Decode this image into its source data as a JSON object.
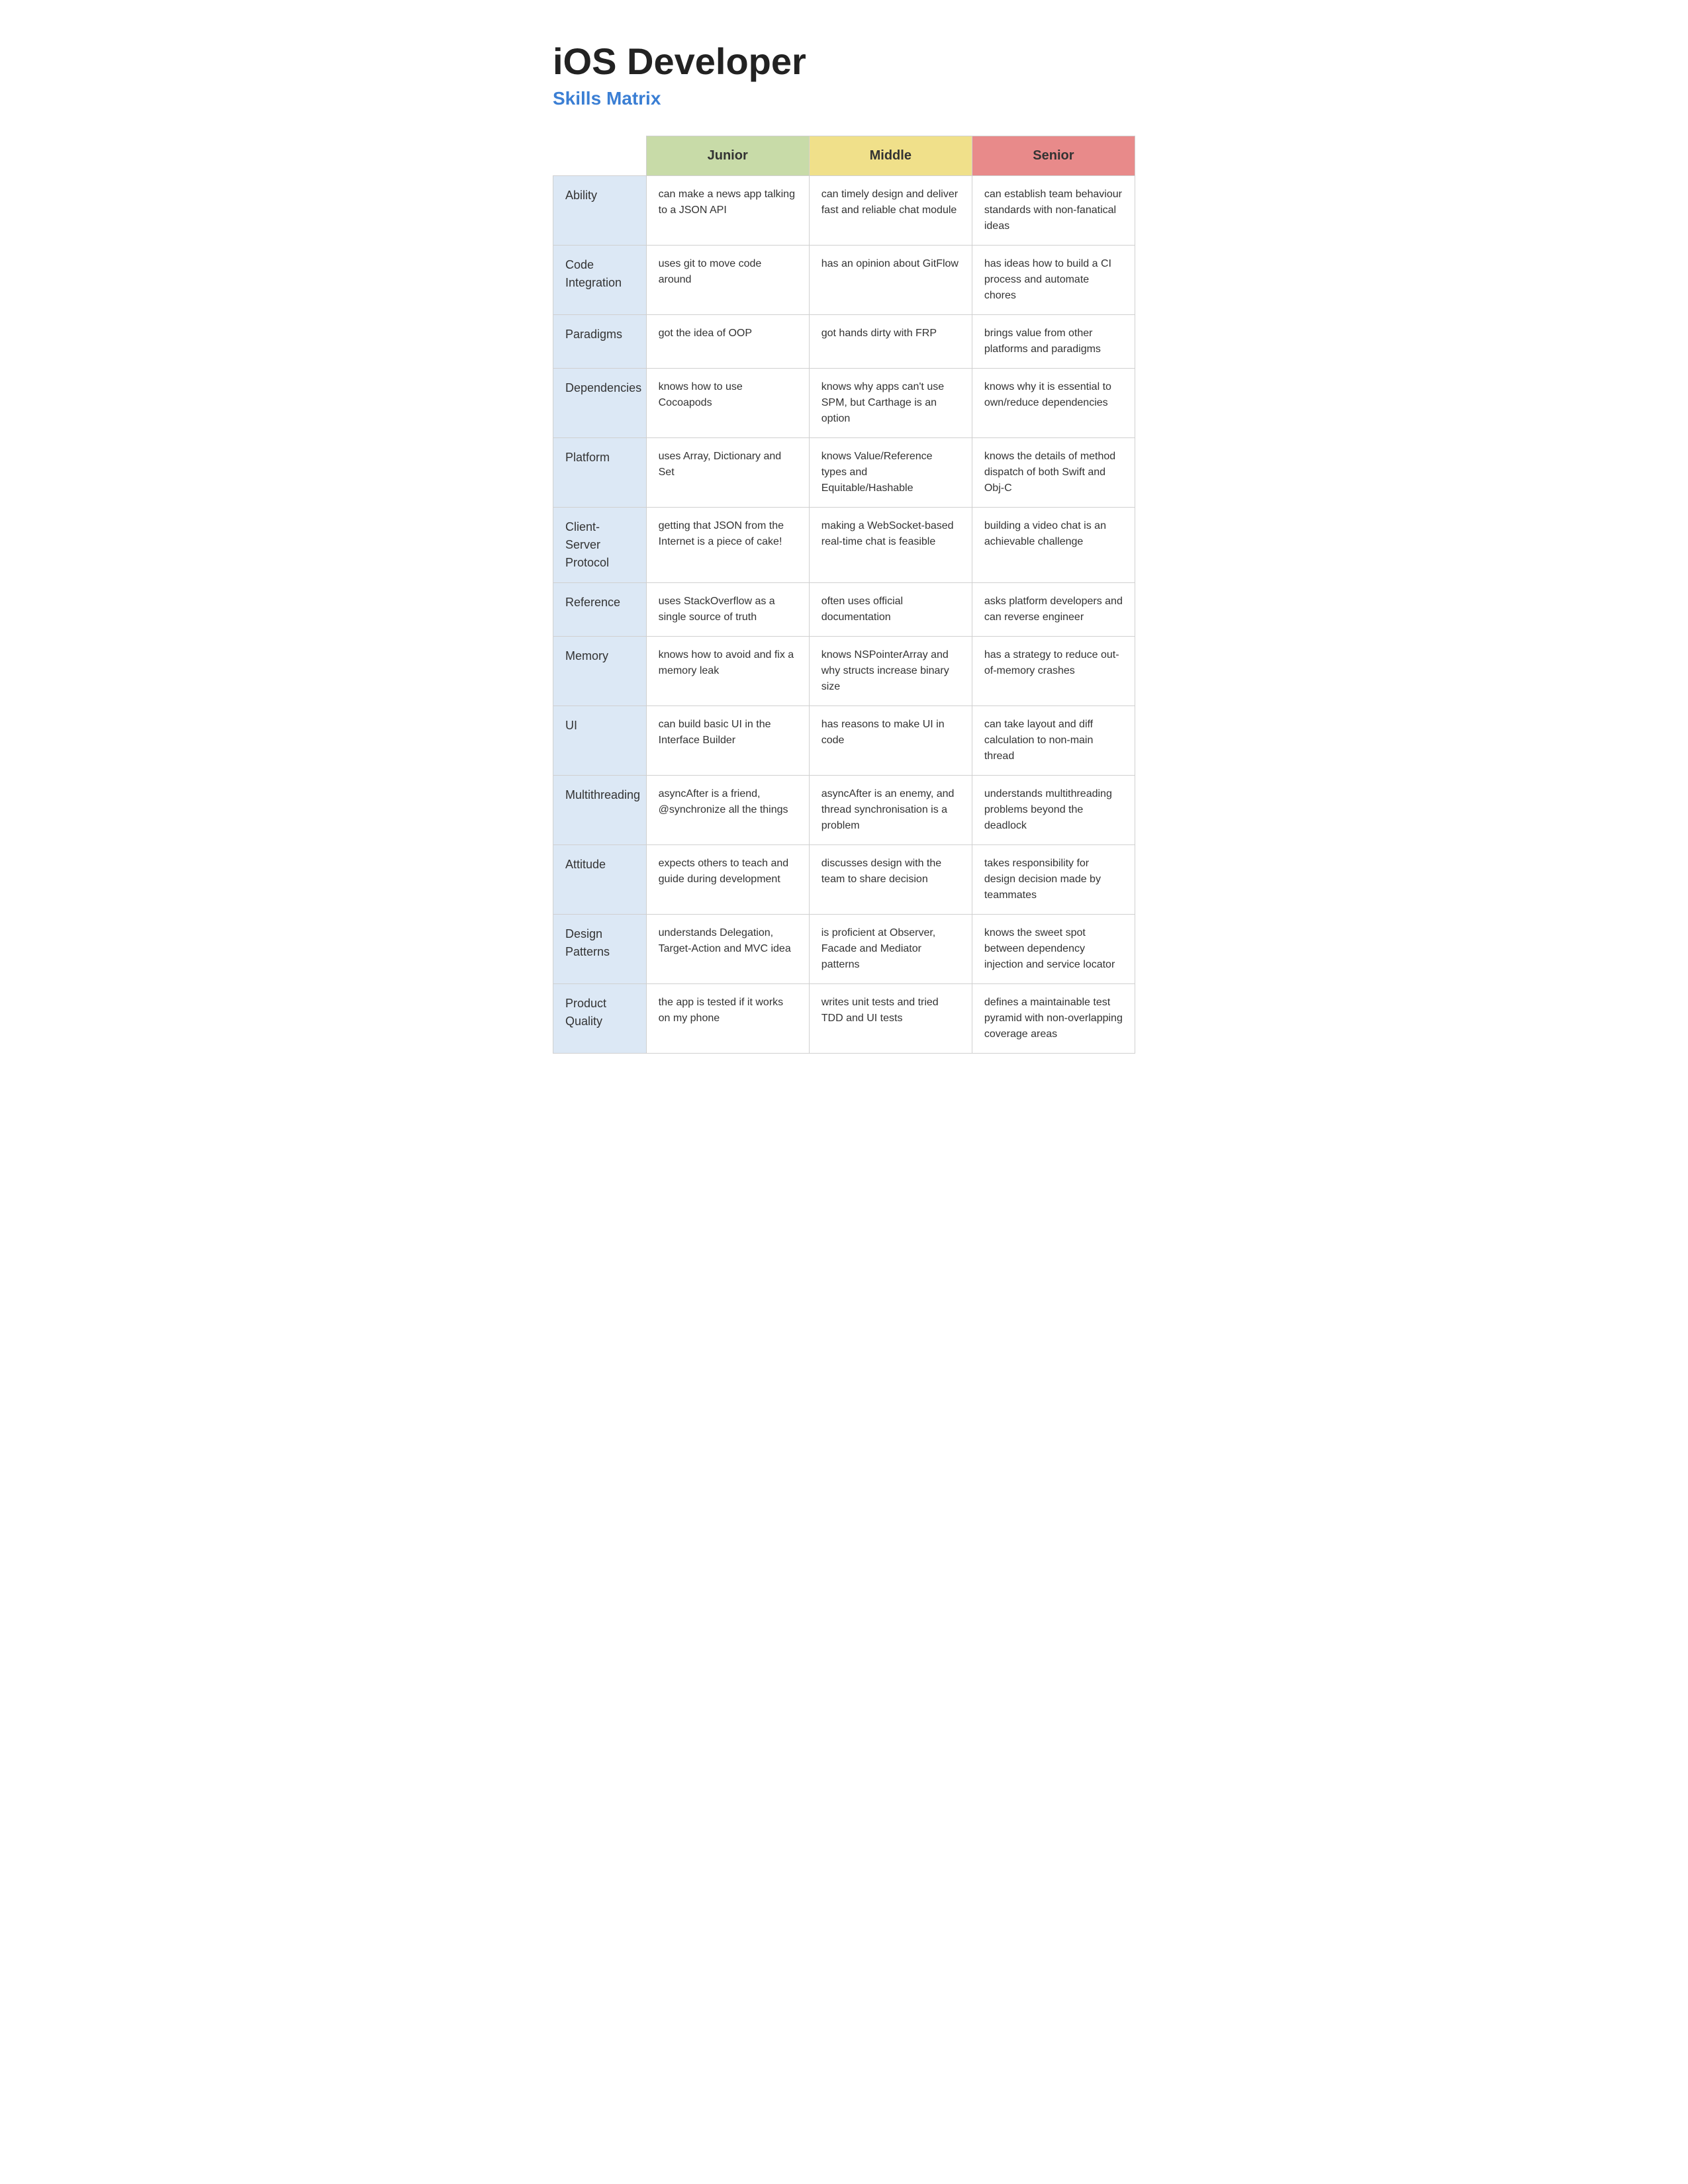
{
  "page": {
    "title": "iOS Developer",
    "subtitle": "Skills Matrix"
  },
  "table": {
    "headers": {
      "empty": "",
      "junior": "Junior",
      "middle": "Middle",
      "senior": "Senior"
    },
    "rows": [
      {
        "skill": "Ability",
        "junior": "can make a news app talking to a JSON API",
        "middle": "can timely design and deliver fast and reliable chat module",
        "senior": "can establish team behaviour standards with non-fanatical ideas"
      },
      {
        "skill": "Code Integration",
        "junior": "uses git to move code around",
        "middle": "has an opinion about GitFlow",
        "senior": "has ideas how to build a CI process and automate chores"
      },
      {
        "skill": "Paradigms",
        "junior": "got the idea of OOP",
        "middle": "got hands dirty with FRP",
        "senior": "brings value from other platforms and paradigms"
      },
      {
        "skill": "Dependencies",
        "junior": "knows how to use Cocoapods",
        "middle": "knows why apps can't use SPM, but Carthage is an option",
        "senior": "knows why it is essential to own/reduce dependencies"
      },
      {
        "skill": "Platform",
        "junior": "uses Array, Dictionary and Set",
        "middle": "knows Value/Reference types and Equitable/Hashable",
        "senior": "knows the details of method dispatch of both Swift and Obj-C"
      },
      {
        "skill": "Client-Server Protocol",
        "junior": "getting that JSON from the Internet is a piece of cake!",
        "middle": "making a WebSocket-based real-time chat is feasible",
        "senior": "building a video chat is an achievable challenge"
      },
      {
        "skill": "Reference",
        "junior": "uses StackOverflow as a single source of truth",
        "middle": "often uses official documentation",
        "senior": "asks platform developers and can reverse engineer"
      },
      {
        "skill": "Memory",
        "junior": "knows how to avoid and fix a memory leak",
        "middle": "knows NSPointerArray and why structs increase binary size",
        "senior": "has a strategy to reduce out-of-memory crashes"
      },
      {
        "skill": "UI",
        "junior": "can build basic UI in the Interface Builder",
        "middle": "has reasons to make UI in code",
        "senior": "can take layout and diff calculation to non-main thread"
      },
      {
        "skill": "Multithreading",
        "junior": "asyncAfter is a friend, @synchronize all the things",
        "middle": "asyncAfter is an enemy, and thread synchronisation is a problem",
        "senior": "understands multithreading problems beyond the deadlock"
      },
      {
        "skill": "Attitude",
        "junior": "expects others to teach and guide during development",
        "middle": "discusses design with the team to share decision",
        "senior": "takes responsibility for design decision made by teammates"
      },
      {
        "skill": "Design Patterns",
        "junior": "understands Delegation, Target-Action and MVC idea",
        "middle": "is proficient at Observer, Facade and Mediator patterns",
        "senior": "knows the sweet spot between dependency injection and service locator"
      },
      {
        "skill": "Product Quality",
        "junior": "the app is tested if it works on my phone",
        "middle": "writes unit tests and tried TDD and UI tests",
        "senior": "defines a maintainable test pyramid with non-overlapping coverage areas"
      }
    ]
  }
}
